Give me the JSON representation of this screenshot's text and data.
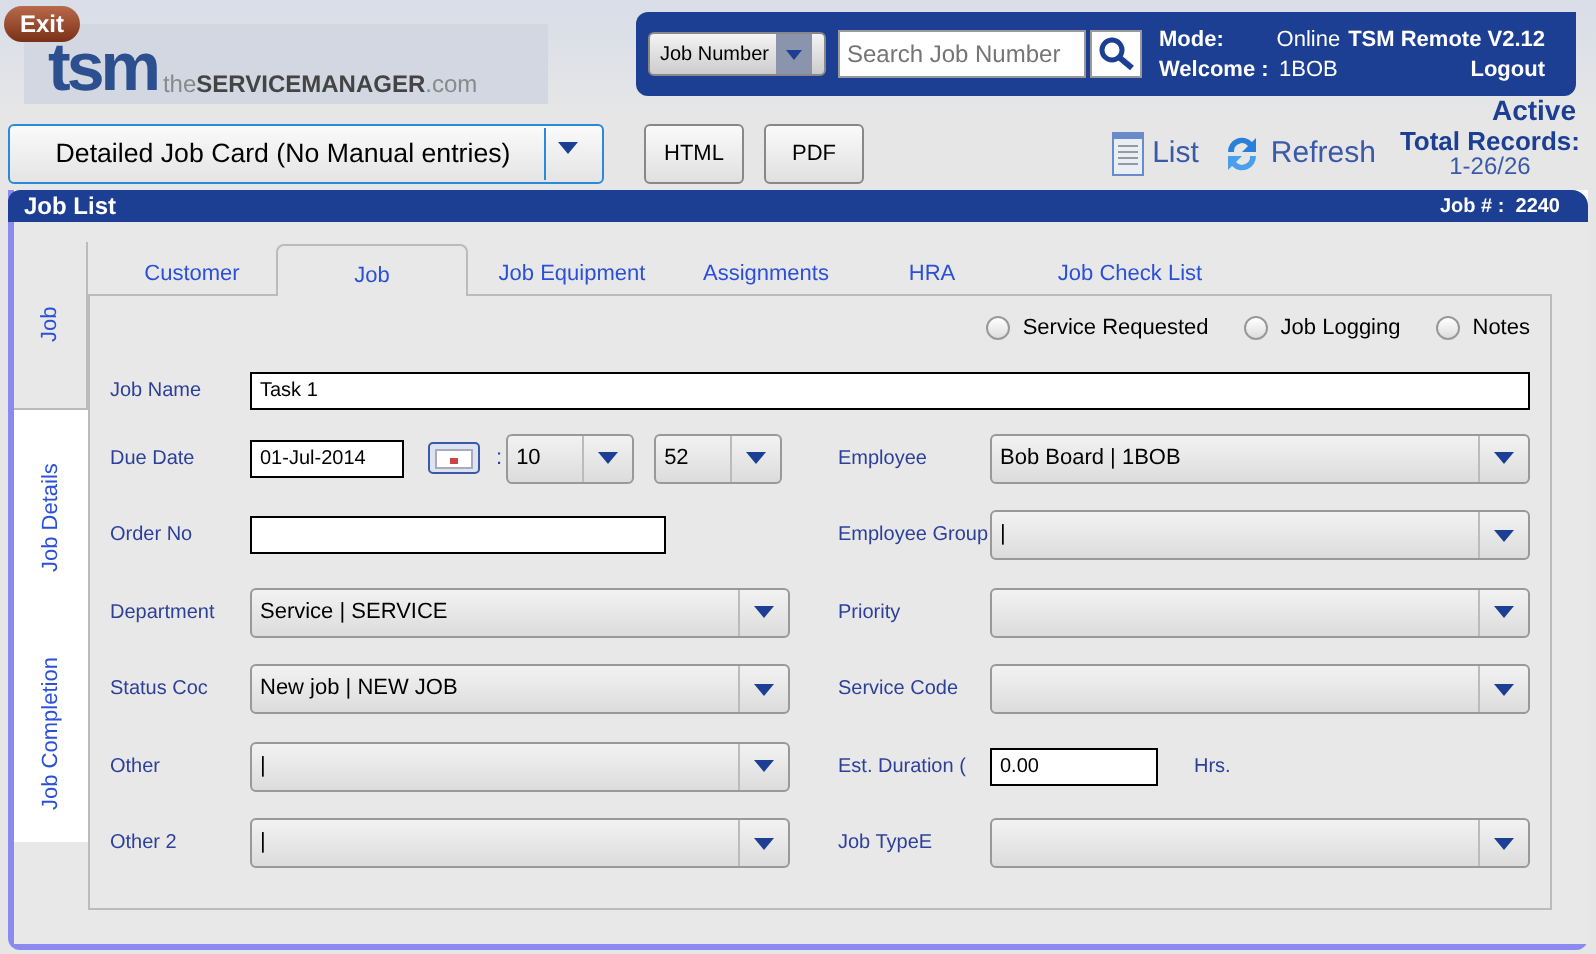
{
  "header": {
    "exit": "Exit",
    "logo": "tsm",
    "tagline": "the**SERVICEMANAGER**.com"
  },
  "search": {
    "field": "Job Number",
    "placeholder": "Search Job Number"
  },
  "session": {
    "mode_label": "Mode:",
    "mode": "Online",
    "product": "TSM Remote V2.12",
    "welcome_label": "Welcome :",
    "user": "1BOB",
    "logout": "Logout"
  },
  "status": "Active",
  "toolbar": {
    "report": "Detailed Job Card (No Manual entries)",
    "buttons": [
      "HTML",
      "PDF"
    ],
    "list": "List",
    "refresh": "Refresh",
    "total_label": "Total Records:",
    "total": "1-26/26"
  },
  "panel": {
    "title": "Job List",
    "job_number": "Job # :  2240"
  },
  "side_tabs": [
    {
      "label": "Job",
      "selected": true
    },
    {
      "label": "Job Details",
      "selected": false
    },
    {
      "label": "Job Completion",
      "selected": false
    }
  ],
  "tabs": [
    {
      "label": "Customer",
      "selected": false
    },
    {
      "label": "Job",
      "selected": true
    },
    {
      "label": "Job Equipment",
      "selected": false
    },
    {
      "label": "Assignments",
      "selected": false
    },
    {
      "label": "HRA",
      "selected": false
    },
    {
      "label": "Job Check List",
      "selected": false
    }
  ],
  "radios": [
    {
      "label": "Service Requested",
      "selected": false
    },
    {
      "label": "Job Logging",
      "selected": false
    },
    {
      "label": "Notes",
      "selected": false
    }
  ],
  "job_name": {
    "label": "Job Name",
    "value": "Task 1"
  },
  "left_fields": [
    {
      "kind": "datetime",
      "label": "Due Date",
      "value": "01-Jul-2014",
      "separator": ":",
      "hour": "10",
      "minute": "52"
    },
    {
      "kind": "text",
      "label": "Order No"
    },
    {
      "kind": "select",
      "label": "Department",
      "value": "Service | SERVICE"
    },
    {
      "kind": "select",
      "label": "Status Coc",
      "value": "New job | NEW JOB"
    },
    {
      "kind": "select",
      "label": "Other",
      "value": "|"
    },
    {
      "kind": "select",
      "label": "Other 2",
      "value": "|"
    }
  ],
  "right_fields": [
    {
      "kind": "select",
      "label": "Employee",
      "value": "Bob Board | 1BOB"
    },
    {
      "kind": "select",
      "label": "Employee Group",
      "value": "|"
    },
    {
      "kind": "select",
      "label": "Priority"
    },
    {
      "kind": "select",
      "label": "Service Code"
    },
    {
      "kind": "number",
      "label": "Est. Duration (",
      "value": "0.00",
      "unit": "Hrs."
    },
    {
      "kind": "select",
      "label": "Job TypeE"
    }
  ]
}
